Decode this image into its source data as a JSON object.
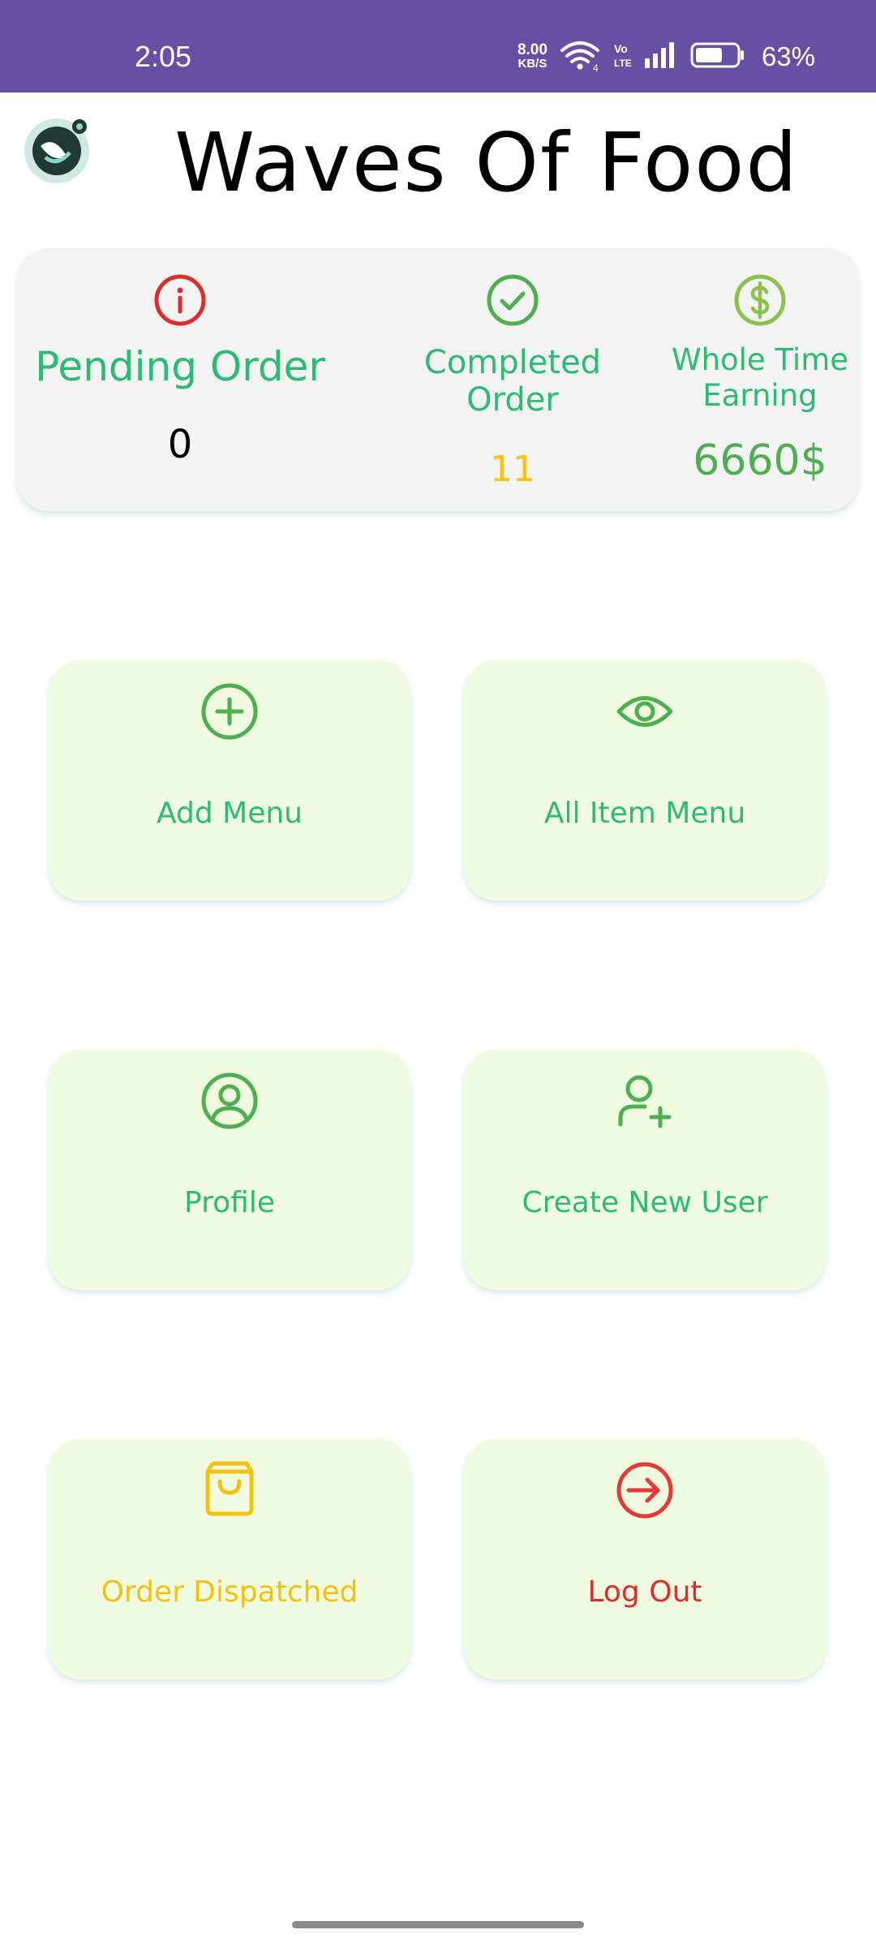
{
  "status_bar": {
    "time": "2:05",
    "net_speed_value": "8.00",
    "net_speed_unit": "KB/S",
    "network_badge": "4",
    "volte_badge": "Vo LTE",
    "battery_percent": "63%",
    "background_color": "#6750a4"
  },
  "header": {
    "title": "Waves Of Food",
    "logo_icon": "waves-of-food-logo"
  },
  "stats": {
    "pending": {
      "label": "Pending Order",
      "value": "0",
      "icon": "info-icon",
      "icon_color": "#e02b2b"
    },
    "completed": {
      "label_line1": "Completed",
      "label_line2": "Order",
      "value": "11",
      "icon": "check-circle-icon",
      "icon_color": "#4caf50",
      "value_color": "#ffc107"
    },
    "earning": {
      "label_line1": "Whole Time",
      "label_line2": "Earning",
      "value": "6660$",
      "icon": "dollar-circle-icon",
      "icon_color": "#8bc34a",
      "value_color": "#4caf50"
    }
  },
  "tiles": [
    {
      "label": "Add Menu",
      "icon": "plus-circle-icon",
      "label_color": "#2bbb73",
      "icon_color": "#4caf50"
    },
    {
      "label": "All Item Menu",
      "icon": "eye-icon",
      "label_color": "#2bbb73",
      "icon_color": "#4caf50"
    },
    {
      "label": "Profile",
      "icon": "user-circle-icon",
      "label_color": "#2bbb73",
      "icon_color": "#4caf50"
    },
    {
      "label": "Create New User",
      "icon": "user-plus-icon",
      "label_color": "#2bbb73",
      "icon_color": "#4caf50"
    },
    {
      "label": "Order Dispatched",
      "icon": "shopping-bag-icon",
      "label_color": "#f5c10f",
      "icon_color": "#f5c10f"
    },
    {
      "label": "Log Out",
      "icon": "logout-icon",
      "label_color": "#e02b2b",
      "icon_color": "#e53935"
    }
  ],
  "colors": {
    "stat_label": "#2bbb73",
    "card_background": "#f3f3f3",
    "tile_background": "#f0fbe0"
  }
}
